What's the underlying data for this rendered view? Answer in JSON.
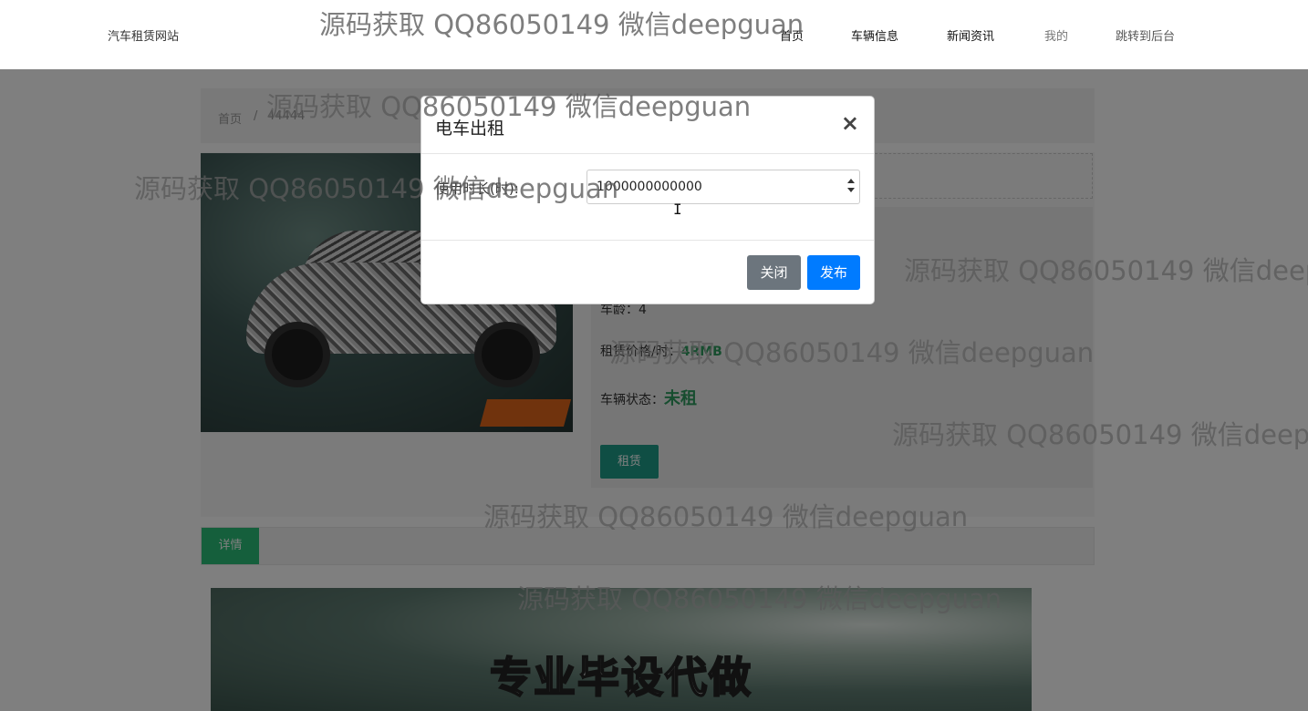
{
  "header": {
    "brand": "汽车租赁网站",
    "nav": [
      "首页",
      "车辆信息",
      "新闻资讯",
      "我的",
      "跳转到后台"
    ]
  },
  "breadcrumb": {
    "home": "首页",
    "separator": "/",
    "current": "44444"
  },
  "car_info": {
    "age_label": "车龄：",
    "age_value": "4",
    "price_label": "租赁价格/时：",
    "price_value": "4RMB",
    "status_label": "车辆状态：",
    "status_value": "未租",
    "rent_button": "租赁"
  },
  "detail": {
    "tab_label": "详情",
    "banner_text": "专业毕设代做"
  },
  "modal": {
    "title": "电车出租",
    "close_symbol": "×",
    "duration_label": "使用时长(时):",
    "duration_value": "1000000000000",
    "close_button": "关闭",
    "publish_button": "发布"
  },
  "watermark": {
    "text": "源码获取 QQ86050149 微信deepguan"
  },
  "colors": {
    "primary": "#007bff",
    "secondary": "#6c757d",
    "teal": "#1e9d88",
    "green": "#2bbf78"
  }
}
